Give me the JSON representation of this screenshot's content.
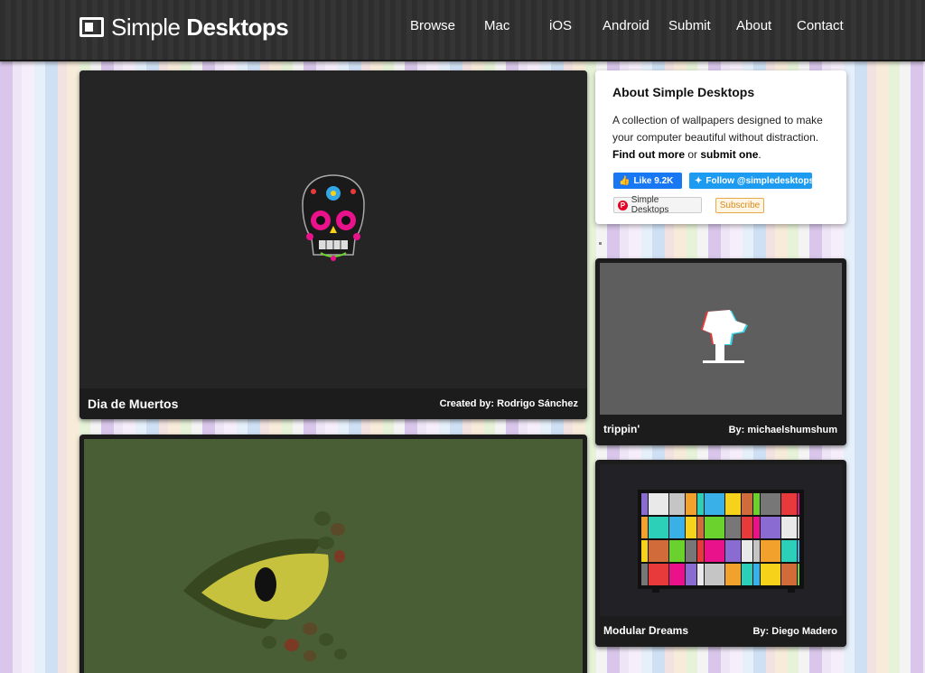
{
  "header": {
    "logo_light": "Simple",
    "logo_bold": "Desktops",
    "nav": [
      "Browse",
      "Mac",
      "iOS",
      "Android",
      "Submit",
      "About",
      "Contact"
    ]
  },
  "about": {
    "title": "About Simple Desktops",
    "text_1": "A collection of wallpapers designed to make your computer beautiful without distraction.",
    "link_more": "Find out more",
    "text_or": "or",
    "link_submit": "submit one",
    "fb_label": "Like 9.2K",
    "tw_label": "Follow @simpledesktops",
    "pin_label": "Simple Desktops",
    "subscribe_label": "Subscribe"
  },
  "wallpapers": [
    {
      "title": "Dia de Muertos",
      "by_prefix": "Created by:",
      "by": "Rodrigo Sánchez",
      "bg": "#252525"
    },
    {
      "title": "",
      "by_prefix": "",
      "by": "",
      "bg": "#4a5e35"
    },
    {
      "title": "trippin'",
      "by_prefix": "By:",
      "by": "michaelshumshum",
      "bg": "#5e5e5e"
    },
    {
      "title": "Modular Dreams",
      "by_prefix": "By:",
      "by": "Diego Madero",
      "bg": "#222226"
    }
  ],
  "colors": {
    "header_bg": "#2e2e2e",
    "fb_blue": "#1877f2",
    "tw_blue": "#1d9bf0",
    "subscribe_orange": "#d88b1d"
  }
}
